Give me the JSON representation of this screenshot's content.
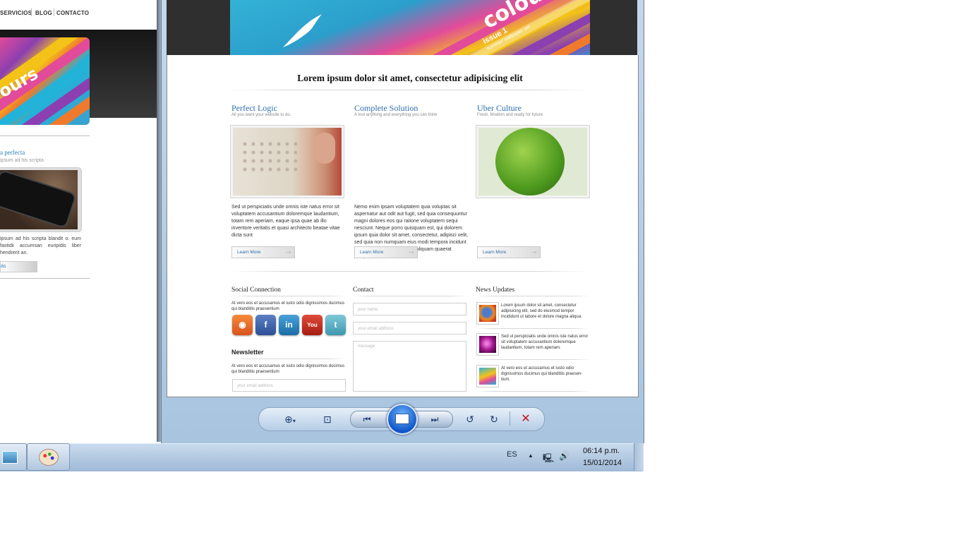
{
  "left_window": {
    "nav": [
      "SERVICIOS",
      "BLOG",
      "CONTACTO"
    ],
    "hero_text": "ours",
    "feature_title": "a perfecta",
    "feature_sub": "ipsum ad his scripta",
    "paragraph": "ipsum ad his scripta blandit o. eum fastidii accumsan euripidis liber hendrerit an.",
    "button_label": "ás"
  },
  "viewer": {
    "headline": "Lorem ipsum dolor sit amet, consectetur adipisicing elit",
    "hero": {
      "text": "colou",
      "issue": "issue 1",
      "issue_sub": "summer wallpaper set"
    },
    "columns": [
      {
        "title": "Perfect Logic",
        "subtitle": "All you want your website to do.",
        "text": "Sed ut perspiciatis unde omnis iste natus error sit voluptatem accusantium doloremque laudantium, totam rem aperiam, eaque ipsa quae ab illo inventore veritatis et quasi architecto beatae vitae dicta sunt",
        "button": "Learn More"
      },
      {
        "title": "Complete Solution",
        "subtitle": "A tool anything and everything you can think",
        "text": "Nemo enim ipsam voluptatem quia voluptas sit aspernatur aut odit aut fugit, sed quia consequuntur magni dolores eos qui ratione voluptatem sequi nesciunt. Neque porro quisquam est, qui dolorem ipsum quia dolor sit amet, consectetur, adipisci velit, sed quia non numquam eius modi tempora incidunt ut labore et dolore magnam aliquam quaerat voluptatem.",
        "button": "Learn More"
      },
      {
        "title": "Uber Culture",
        "subtitle": "Fresh. Modern and ready for future",
        "text": "",
        "button": "Learn More"
      }
    ],
    "social": {
      "title": "Social Connection",
      "text": "At vero eos et accusamus et iusto odio dignissimos ducimus qui blanditiis praesentium",
      "icons": [
        "rss-icon",
        "facebook-icon",
        "linkedin-icon",
        "youtube-icon",
        "twitter-icon"
      ]
    },
    "newsletter": {
      "title": "Newsletter",
      "text": "At vero eos et accusamus et iusto odio dignissimos ducimus qui blanditiis praesentium",
      "email_placeholder": "your email address"
    },
    "contact": {
      "title": "Contact",
      "name_placeholder": "your name",
      "email_placeholder": "your email address",
      "message_placeholder": "message"
    },
    "news": {
      "title": "News Updates",
      "items": [
        "Lorem ipsum dolor sit amet, consectetur adipisicing elit, sed do eiusmod tempor incididunt ut labore et dolore magna aliqua.",
        "Sed ut perspiciatis unde omnis iste natus error sit voluptatem accusantium doloremque laudantium, totam rem aperiam.",
        "At vero eos et accusamus et iusto odio dignissimos ducimus qui blanditiis praesen-tium."
      ]
    }
  },
  "toolbar": {
    "zoom": "zoom-icon",
    "fit": "fit-window-icon",
    "previous": "previous-icon",
    "slideshow": "slideshow-icon",
    "next": "next-icon",
    "rotate_left": "rotate-counterclockwise-icon",
    "rotate_right": "rotate-clockwise-icon",
    "delete": "delete-icon"
  },
  "taskbar": {
    "language": "ES",
    "time": "06:14 p.m.",
    "date": "15/01/2014"
  }
}
